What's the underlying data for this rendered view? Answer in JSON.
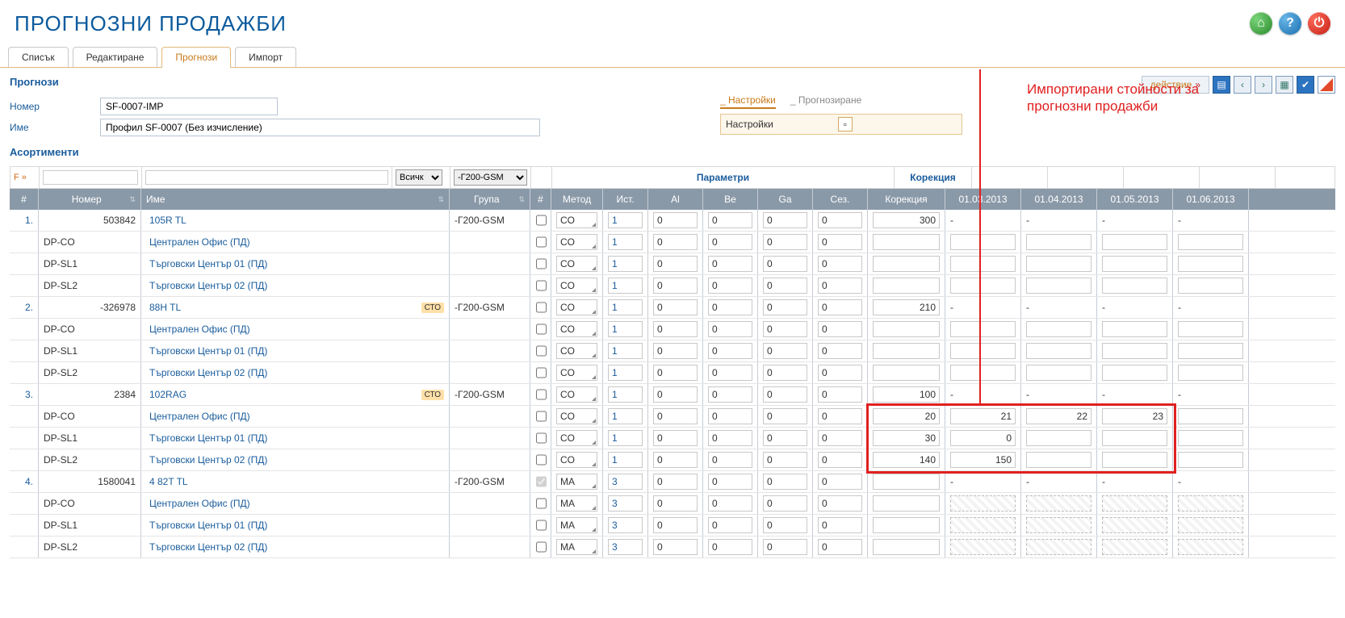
{
  "header": {
    "title": "ПРОГНОЗНИ ПРОДАЖБИ"
  },
  "tabs": {
    "list": "Списък",
    "edit": "Редактиране",
    "forecast": "Прогнози",
    "import": "Импорт"
  },
  "section_title": "Прогнози",
  "action_button": "действие",
  "form": {
    "number_label": "Номер",
    "number_value": "SF-0007-IMP",
    "name_label": "Име",
    "name_value": "Профил SF-0007 (Без изчисление)"
  },
  "sub_tabs": {
    "settings": "Настройки",
    "forecast": "Прогнозиране"
  },
  "settings_box": {
    "label": "Настройки"
  },
  "assort_title": "Асортименти",
  "annotation": "Импортирани стойности за\nпрогнозни продажби",
  "filters": {
    "link": "F »",
    "sel_all": "Всичк",
    "sel_group": "-Г200-GSM"
  },
  "group_headers": {
    "params": "Параметри",
    "corr": "Корекция"
  },
  "columns": {
    "idx": "#",
    "num": "Номер",
    "name": "Име",
    "grp": "Група",
    "row_num": "#",
    "method": "Метод",
    "src": "Ист.",
    "al": "Al",
    "be": "Be",
    "ga": "Ga",
    "sez": "Сез.",
    "corr": "Корекция",
    "m1": "01.03.2013",
    "m2": "01.04.2013",
    "m3": "01.05.2013",
    "m4": "01.06.2013"
  },
  "params_default": {
    "method": "CO",
    "src": "1",
    "al": "0",
    "be": "0",
    "ga": "0",
    "sez": "0"
  },
  "groups": {
    "grp": "-Г200-GSM",
    "dp_co": "DP-CO",
    "dp_sl1": "DP-SL1",
    "dp_sl2": "DP-SL2",
    "central": "Централен Офис (ПД)",
    "tc01": "Търговски Център 01 (ПД)",
    "tc02": "Търговски Център 02 (ПД)"
  },
  "rows": [
    {
      "idx": "1.",
      "num": "503842",
      "name": "105R TL",
      "badge": "",
      "corr": "300"
    },
    {
      "idx": "2.",
      "num": "-326978",
      "name": "88H TL",
      "badge": "СТО",
      "corr": "210"
    },
    {
      "idx": "3.",
      "num": "2384",
      "name": "102RAG",
      "badge": "СТО",
      "corr": "100"
    },
    {
      "idx": "4.",
      "num": "1580041",
      "name": "4 82T TL",
      "badge": "",
      "corr": "",
      "method": "MA",
      "src": "3",
      "checked": true
    }
  ],
  "import_vals": {
    "r1": {
      "corr": "20",
      "m1": "21",
      "m2": "22",
      "m3": "23"
    },
    "r2": {
      "corr": "30",
      "m1": "0"
    },
    "r3": {
      "corr": "140",
      "m1": "150"
    }
  }
}
